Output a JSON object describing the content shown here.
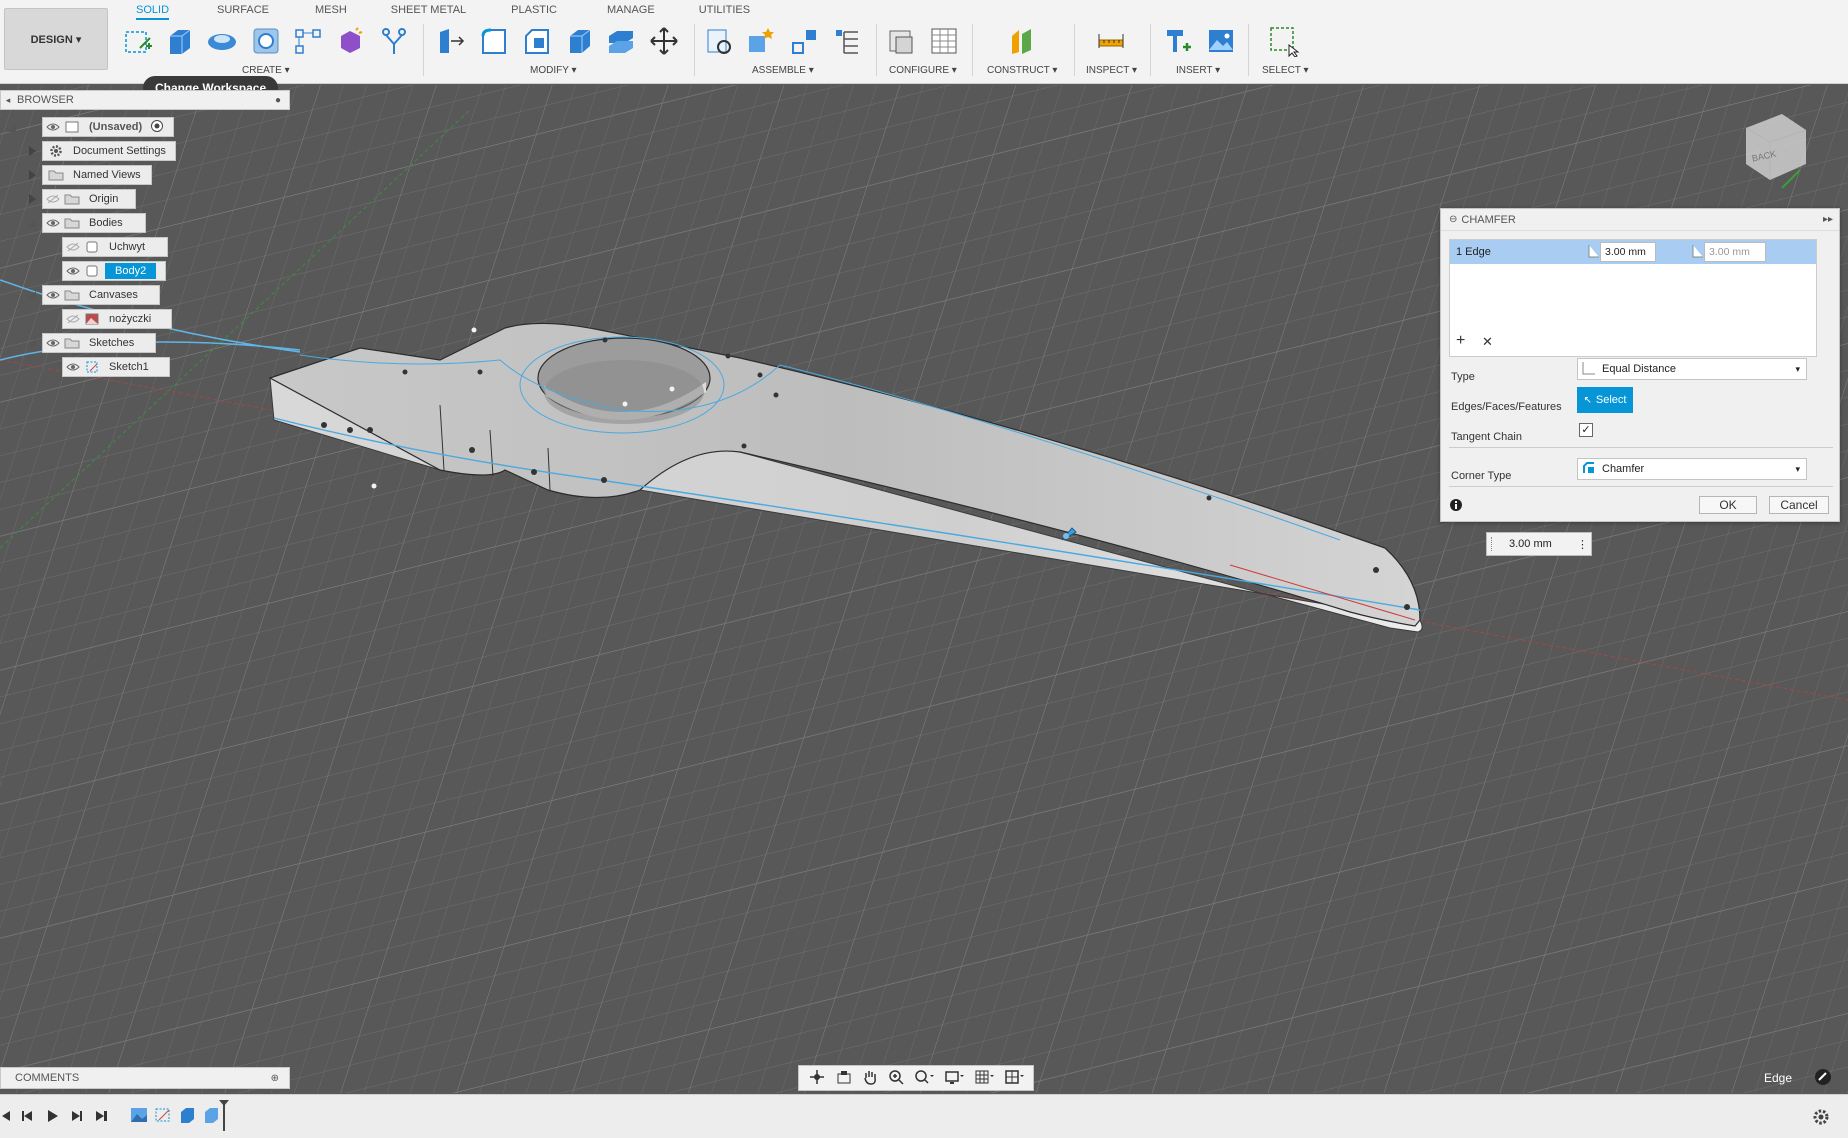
{
  "toolbar": {
    "workspace_label": "DESIGN ▾",
    "tooltip": "Change Workspace",
    "tabs": [
      {
        "label": "SOLID",
        "active": true
      },
      {
        "label": "SURFACE"
      },
      {
        "label": "MESH"
      },
      {
        "label": "SHEET METAL"
      },
      {
        "label": "PLASTIC"
      },
      {
        "label": "MANAGE"
      },
      {
        "label": "UTILITIES"
      }
    ],
    "groups": {
      "create": "CREATE ▾",
      "modify": "MODIFY ▾",
      "assemble": "ASSEMBLE ▾",
      "configure": "CONFIGURE ▾",
      "construct": "CONSTRUCT ▾",
      "inspect": "INSPECT ▾",
      "insert": "INSERT ▾",
      "select": "SELECT ▾"
    }
  },
  "browser": {
    "title": "BROWSER",
    "nodes": {
      "root": "(Unsaved)",
      "document_settings": "Document Settings",
      "named_views": "Named Views",
      "origin": "Origin",
      "bodies": "Bodies",
      "uchwyt": "Uchwyt",
      "body2": "Body2",
      "canvases": "Canvases",
      "nozyczki": "nożyczki",
      "sketches": "Sketches",
      "sketch1": "Sketch1"
    }
  },
  "viewcube": {
    "face": "BACK"
  },
  "chamfer": {
    "title": "CHAMFER",
    "edge_row": {
      "label": "1 Edge",
      "distance1": "3.00 mm",
      "distance2": "3.00 mm"
    },
    "type_label": "Type",
    "type_value": "Equal Distance",
    "edges_label": "Edges/Faces/Features",
    "select_label": "Select",
    "tangent_label": "Tangent Chain",
    "tangent_checked": true,
    "corner_label": "Corner Type",
    "corner_value": "Chamfer",
    "ok": "OK",
    "cancel": "Cancel"
  },
  "dimension_input": "3.00 mm",
  "comments": "COMMENTS",
  "selection_status": "Edge"
}
